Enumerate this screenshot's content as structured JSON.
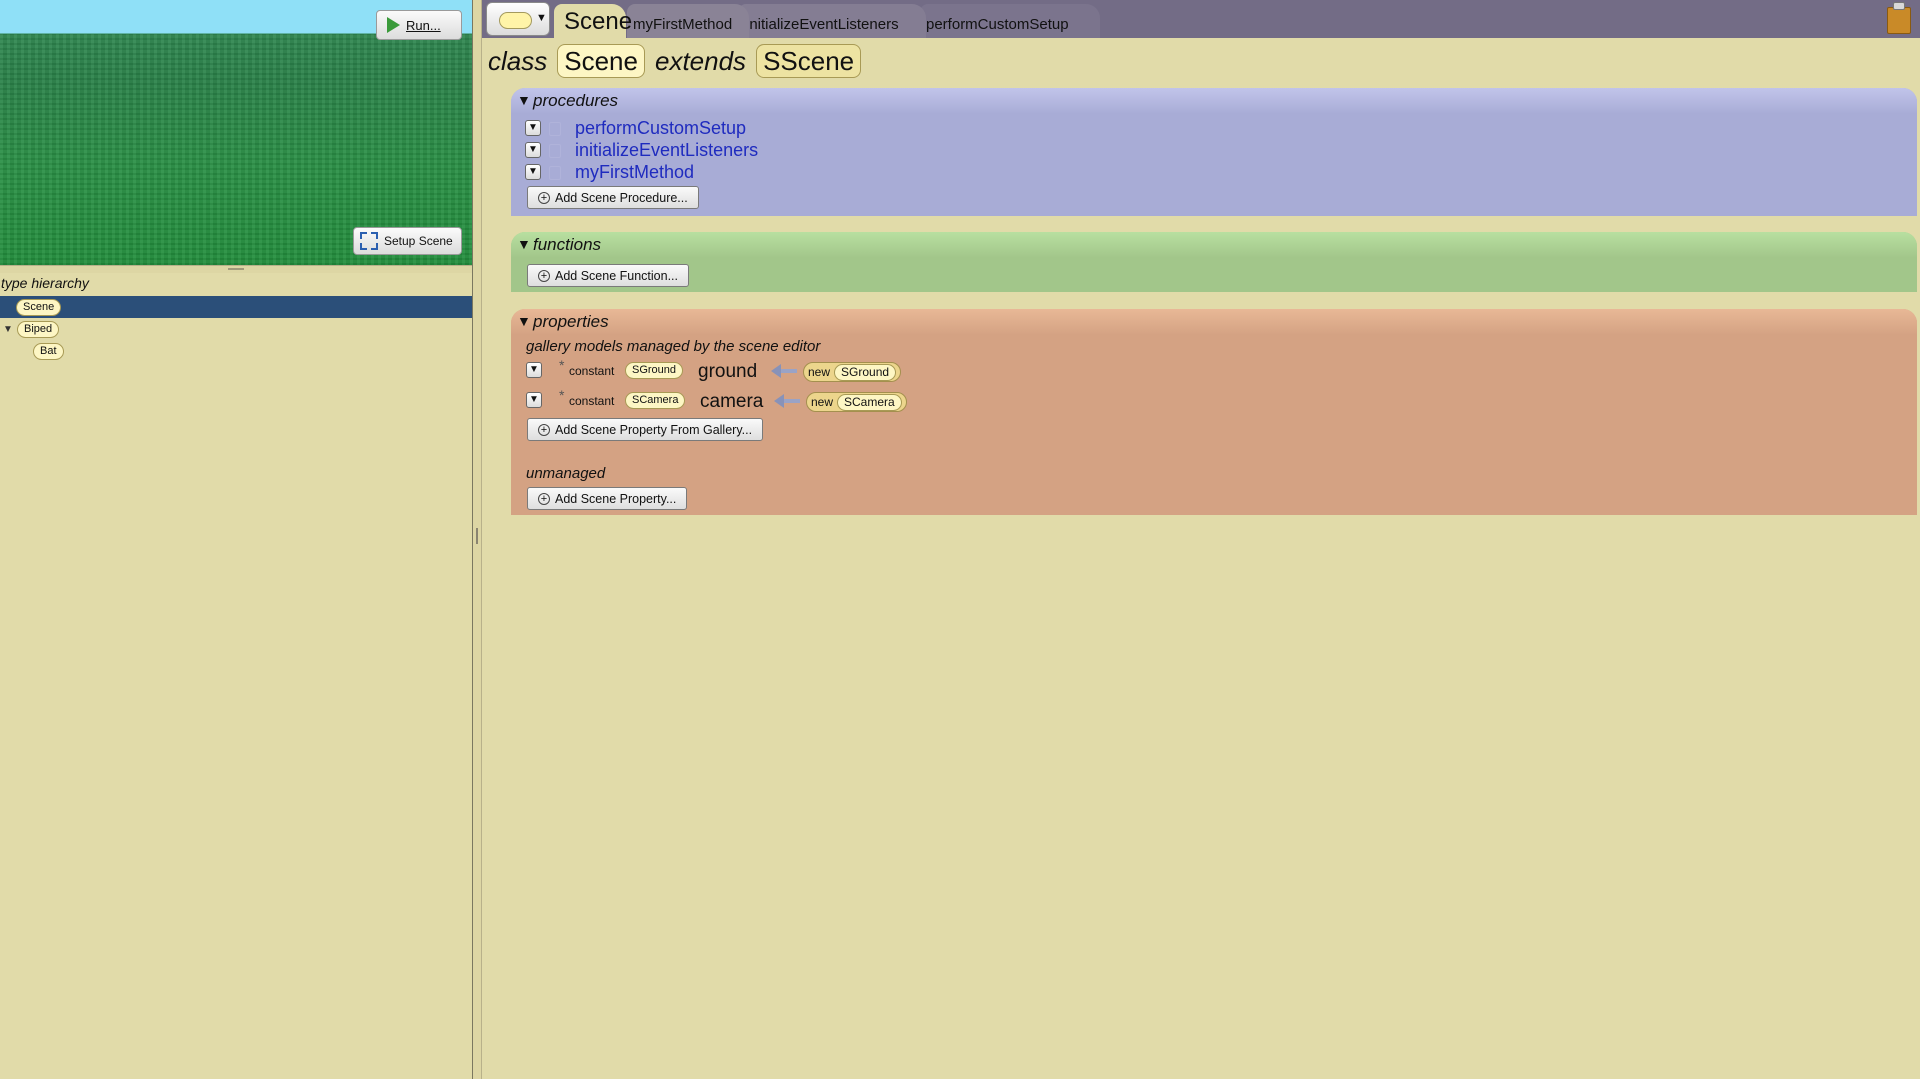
{
  "viewport": {
    "run_label": "Run...",
    "setup_scene_label": "Setup Scene"
  },
  "type_hierarchy": {
    "title": "type hierarchy",
    "items": [
      {
        "label": "Scene",
        "selected": true
      },
      {
        "label": "Biped",
        "expanded": true
      },
      {
        "label": "Bat"
      }
    ]
  },
  "tabs": [
    {
      "label": "Scene",
      "active": true
    },
    {
      "label": "myFirstMethod"
    },
    {
      "label": "initializeEventListeners"
    },
    {
      "label": "performCustomSetup"
    }
  ],
  "class_header": {
    "class_kw": "class",
    "class_name": "Scene",
    "extends_kw": "extends",
    "super_name": "SScene"
  },
  "procedures": {
    "title": "procedures",
    "items": [
      "performCustomSetup",
      "initializeEventListeners",
      "myFirstMethod"
    ],
    "add_label": "Add Scene Procedure..."
  },
  "functions": {
    "title": "functions",
    "add_label": "Add Scene Function..."
  },
  "properties": {
    "title": "properties",
    "managed_label": "gallery models managed by the scene editor",
    "items": [
      {
        "star": "*",
        "kw": "constant",
        "type": "SGround",
        "name": "ground",
        "new_kw": "new",
        "new_type": "SGround"
      },
      {
        "star": "*",
        "kw": "constant",
        "type": "SCamera",
        "name": "camera",
        "new_kw": "new",
        "new_type": "SCamera"
      }
    ],
    "add_gallery_label": "Add Scene Property From Gallery...",
    "unmanaged_label": "unmanaged",
    "add_label": "Add Scene Property..."
  },
  "colors": {
    "procedures": "#a8acd6",
    "functions": "#a2c68a",
    "properties": "#d4a283",
    "background": "#e1dba9",
    "selection": "#2b4f79"
  }
}
